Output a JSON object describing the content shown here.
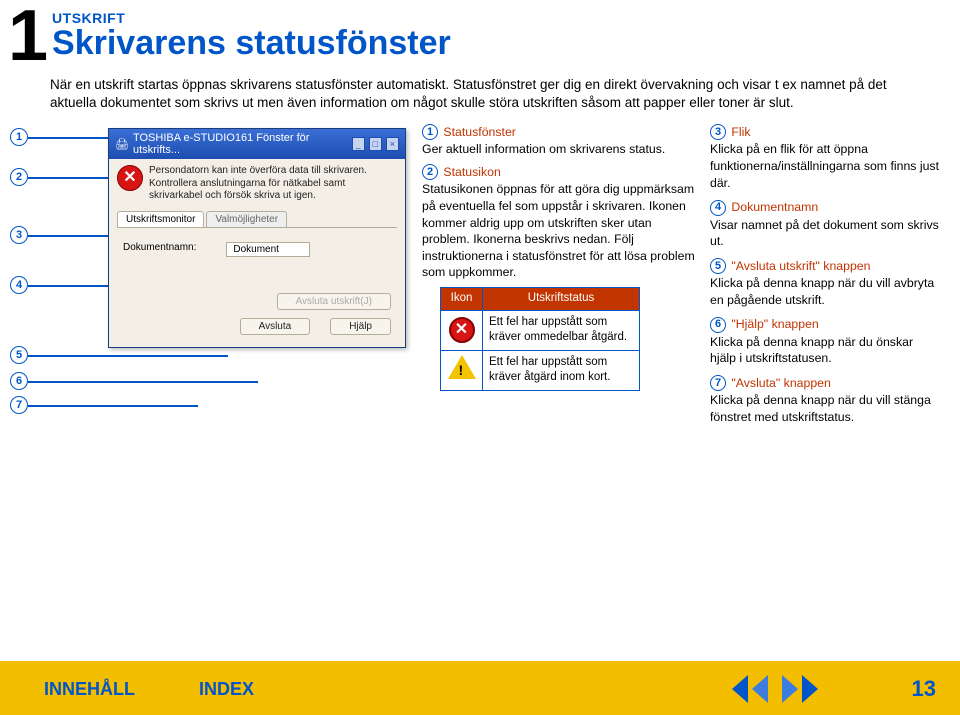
{
  "header": {
    "section_number": "1",
    "kicker": "UTSKRIFT",
    "title": "Skrivarens statusfönster"
  },
  "intro": "När en utskrift startas öppnas skrivarens statusfönster automatiskt. Statusfönstret ger dig en direkt övervakning och visar t ex namnet på det aktuella dokumentet som skrivs ut men även information om något skulle störa utskriften såsom att papper eller toner är slut.",
  "callout_numbers": [
    "1",
    "2",
    "3",
    "4",
    "5",
    "6",
    "7"
  ],
  "dialog": {
    "title": "TOSHIBA e-STUDIO161 Fönster för utskrifts...",
    "message": "Persondatorn kan inte överföra data till skrivaren. Kontrollera anslutningarna för nätkabel samt skrivarkabel och försök skriva ut igen.",
    "tab1": "Utskriftsmonitor",
    "tab2": "Valmöjligheter",
    "doc_label": "Dokumentnamn:",
    "doc_value": "Dokument",
    "btn_cancel_print": "Avsluta utskrift(J)",
    "btn_close": "Avsluta",
    "btn_help": "Hjälp"
  },
  "middle": {
    "i1_h": "Statusfönster",
    "i1_b": "Ger aktuell information om skrivarens status.",
    "i2_h": "Statusikon",
    "i2_b": "Statusikonen öppnas för att göra dig uppmärksam på eventuella fel som uppstår i skrivaren. Ikonen kommer aldrig upp om utskriften sker utan problem. Ikonerna beskrivs nedan. Följ instruktionerna i statusfönstret för att lösa problem som uppkommer.",
    "tbl_h1": "Ikon",
    "tbl_h2": "Utskriftstatus",
    "tbl_r1": "Ett fel har uppstått som kräver ommedelbar åtgärd.",
    "tbl_r2": "Ett fel har uppstått som kräver åtgärd inom kort."
  },
  "right": {
    "i3_h": "Flik",
    "i3_b": "Klicka på en flik för att öppna funktionerna/inställningarna som finns just där.",
    "i4_h": "Dokumentnamn",
    "i4_b": "Visar namnet på det dokument som skrivs ut.",
    "i5_h": "\"Avsluta utskrift\" knappen",
    "i5_b": "Klicka på denna knapp när du vill avbryta en pågående utskrift.",
    "i6_h": "\"Hjälp\" knappen",
    "i6_b": "Klicka på denna knapp när du önskar hjälp i utskriftstatusen.",
    "i7_h": "\"Avsluta\" knappen",
    "i7_b": "Klicka på denna knapp när du vill stänga fönstret med utskriftstatus."
  },
  "footer": {
    "contents": "INNEHÅLL",
    "index": "INDEX",
    "page": "13"
  }
}
